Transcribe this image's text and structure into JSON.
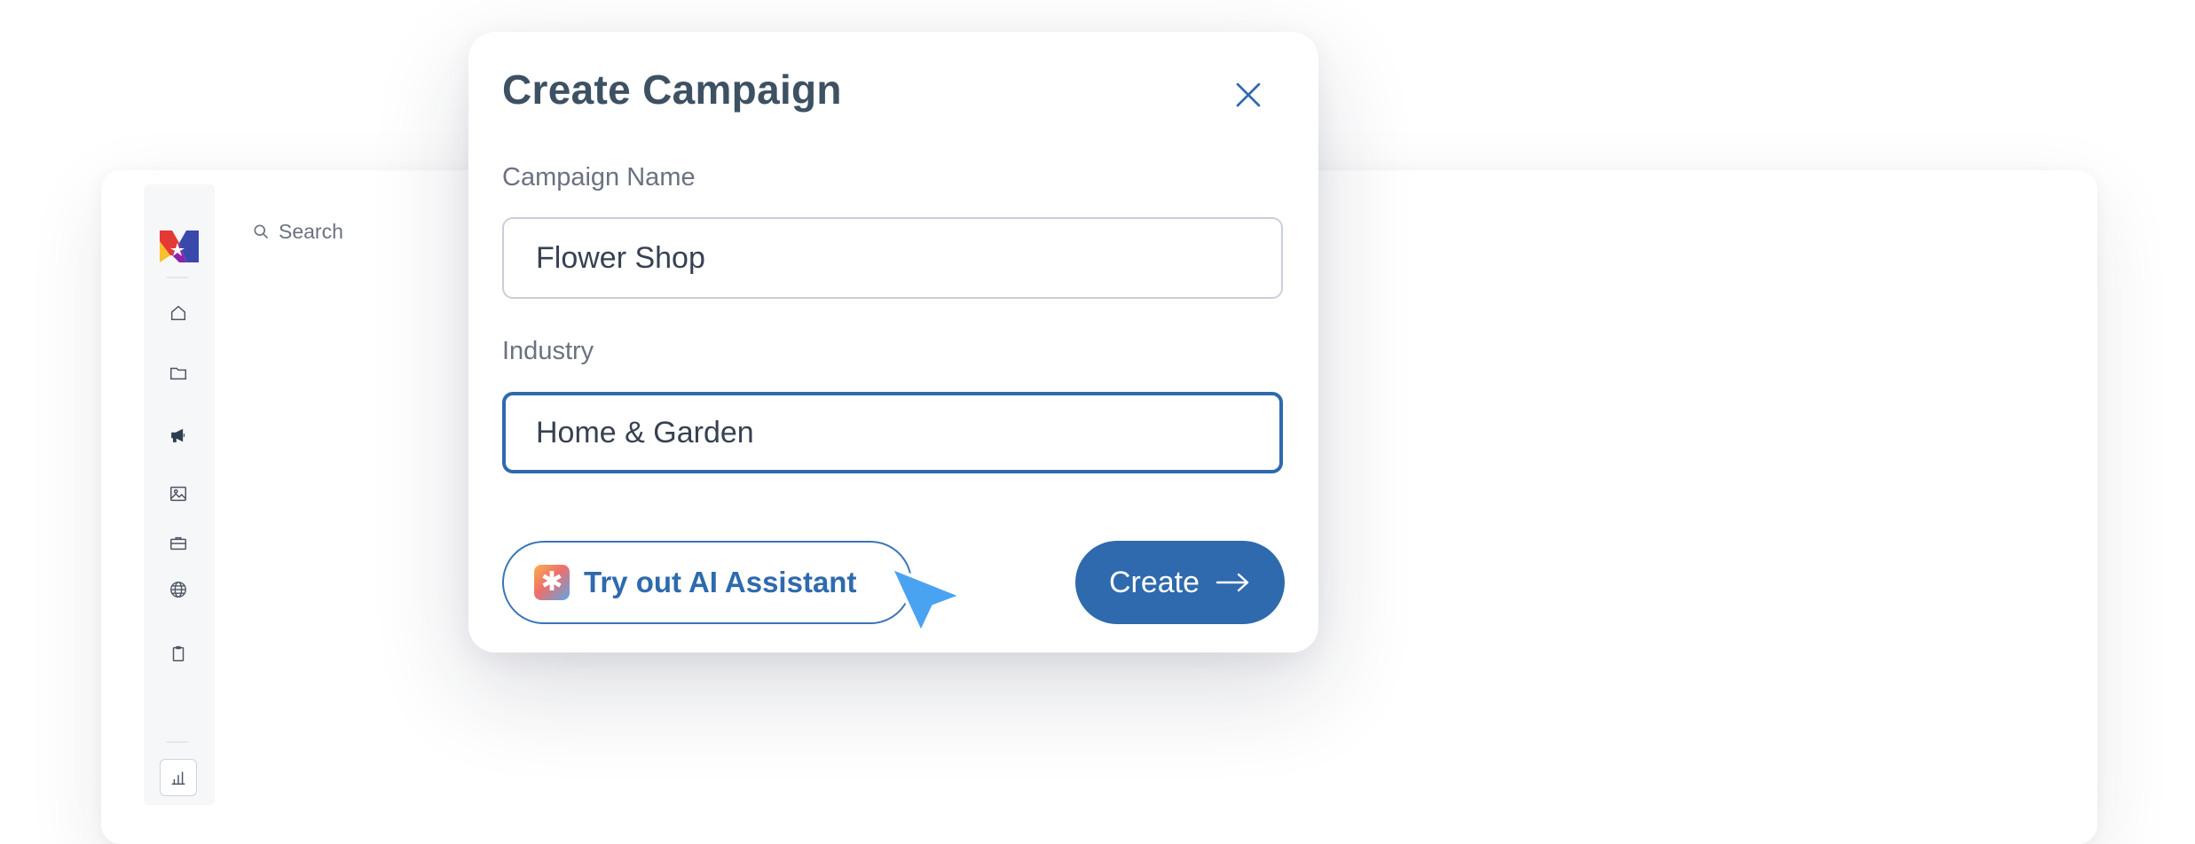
{
  "search": {
    "placeholder": "Search"
  },
  "sidebar": {
    "items": [
      {
        "icon": "home-icon"
      },
      {
        "icon": "folder-icon"
      },
      {
        "icon": "megaphone-icon"
      },
      {
        "icon": "image-icon"
      },
      {
        "icon": "briefcase-icon"
      },
      {
        "icon": "globe-icon"
      },
      {
        "icon": "clipboard-icon"
      },
      {
        "icon": "chart-icon"
      }
    ]
  },
  "modal": {
    "title": "Create Campaign",
    "campaign_name_label": "Campaign Name",
    "campaign_name_value": "Flower Shop",
    "industry_label": "Industry",
    "industry_value": "Home & Garden",
    "ai_button_label": "Try out AI Assistant",
    "create_button_label": "Create"
  },
  "colors": {
    "accent": "#2e6aad",
    "title": "#3d5163",
    "cursor": "#4aa3f0"
  }
}
